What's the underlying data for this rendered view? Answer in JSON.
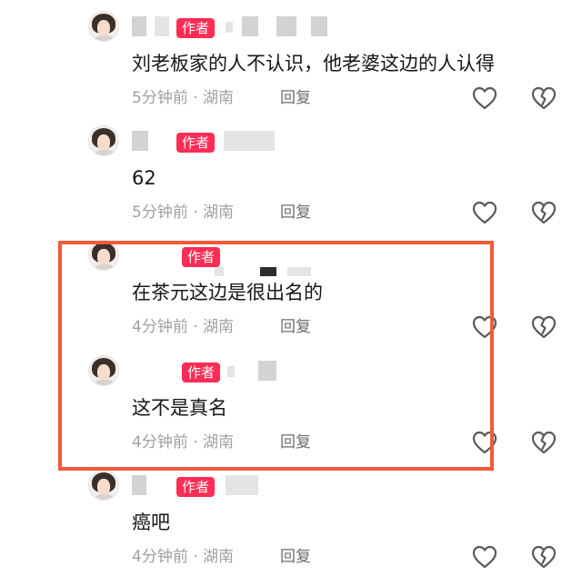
{
  "author_badge": "作者",
  "reply_label": "回复",
  "comments": [
    {
      "text": "刘老板家的人不认识，他老婆这边的人认得",
      "meta": "5分钟前 · 湖南"
    },
    {
      "text": "62",
      "meta": "5分钟前 · 湖南"
    },
    {
      "text": "在茶元这边是很出名的",
      "meta": "4分钟前 · 湖南"
    },
    {
      "text": "这不是真名",
      "meta": "4分钟前 · 湖南"
    },
    {
      "text": "癌吧",
      "meta": "4分钟前 · 湖南"
    }
  ],
  "icons": {
    "like": "heart-outline-icon",
    "dislike": "broken-heart-icon"
  },
  "colors": {
    "author_badge": "#fe2c55",
    "highlight_box": "#f25a38",
    "meta_text": "#a0a0a0",
    "reply_text": "#6e6e6e"
  }
}
